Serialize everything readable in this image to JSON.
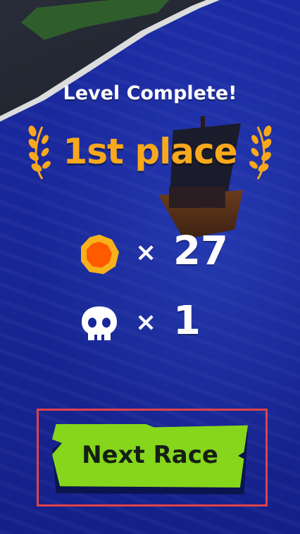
{
  "result": {
    "title": "Level Complete!",
    "place": "1st place"
  },
  "rewards": [
    {
      "icon": "coin-icon",
      "multiplier": "×",
      "count": "27"
    },
    {
      "icon": "skull-icon",
      "multiplier": "×",
      "count": "1"
    }
  ],
  "next_button": {
    "label": "Next Race"
  },
  "colors": {
    "place_gold": "#f7a81c",
    "coin_orange": "#ff5a00",
    "button_green": "#86d61c",
    "highlight_red": "#e0424a",
    "water_blue": "#17279a"
  }
}
